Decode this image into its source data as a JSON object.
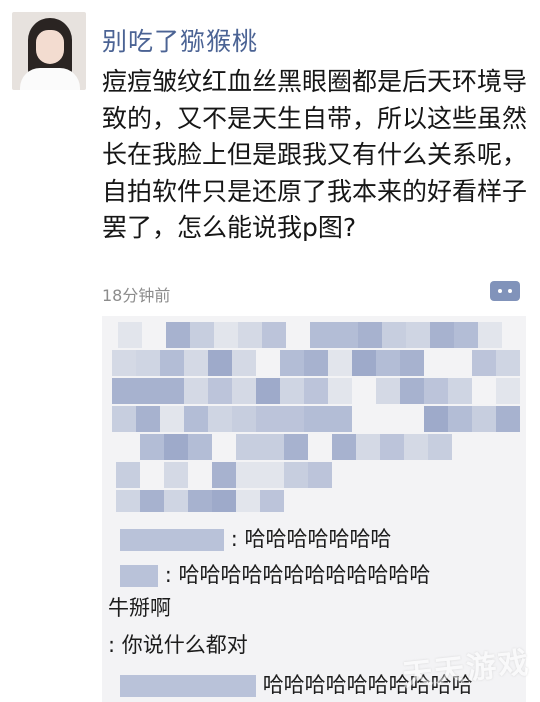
{
  "post": {
    "username": "别吃了猕猴桃",
    "text": "痘痘皱纹红血丝黑眼圈都是后天环境导致的，又不是天生自带，所以这些虽然长在我脸上但是跟我又有什么关系呢，自拍软件只是还原了我本来的好看样子罢了，怎么能说我p图?",
    "time": "18分钟前"
  },
  "comments": [
    {
      "text": ": 哈哈哈哈哈哈哈"
    },
    {
      "text": ": 哈哈哈哈哈哈哈哈哈哈哈哈"
    },
    {
      "text": "牛掰啊"
    },
    {
      "text": ": 你说什么都对"
    },
    {
      "text": "哈哈哈哈哈哈哈哈哈哈"
    }
  ],
  "icons": {
    "avatar": "avatar-image",
    "comment": "comment-icon"
  },
  "colors": {
    "username": "#4b6394",
    "comment_button": "#8193ba",
    "comment_bg": "#f3f3f5",
    "mosaic": "#b9c2d9"
  },
  "watermark": "天天游戏"
}
